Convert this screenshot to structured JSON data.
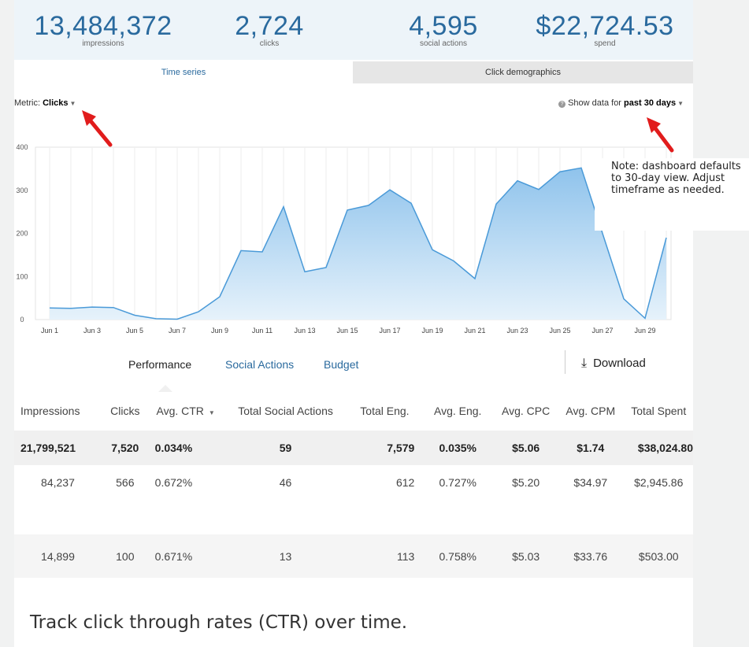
{
  "stats": [
    {
      "value": "13,484,372",
      "label": "impressions"
    },
    {
      "value": "2,724",
      "label": "clicks"
    },
    {
      "value": "4,595",
      "label": "social actions"
    },
    {
      "value": "$22,724.53",
      "label": "spend"
    }
  ],
  "tabs": {
    "time_series": "Time series",
    "click_demographics": "Click demographics"
  },
  "metric": {
    "prefix": "Metric:",
    "value": "Clicks"
  },
  "range": {
    "prefix": "Show data for",
    "value": "past 30 days"
  },
  "note": "Note: dashboard defaults to 30-day view. Adjust timeframe as needed.",
  "chart_data": {
    "type": "area",
    "x": [
      "Jun 1",
      "Jun 2",
      "Jun 3",
      "Jun 4",
      "Jun 5",
      "Jun 6",
      "Jun 7",
      "Jun 8",
      "Jun 9",
      "Jun 10",
      "Jun 11",
      "Jun 12",
      "Jun 13",
      "Jun 14",
      "Jun 15",
      "Jun 16",
      "Jun 17",
      "Jun 18",
      "Jun 19",
      "Jun 20",
      "Jun 21",
      "Jun 22",
      "Jun 23",
      "Jun 24",
      "Jun 25",
      "Jun 26",
      "Jun 27",
      "Jun 28",
      "Jun 29",
      "Jun 30"
    ],
    "x_tick_labels": [
      "Jun 1",
      "Jun 3",
      "Jun 5",
      "Jun 7",
      "Jun 9",
      "Jun 11",
      "Jun 13",
      "Jun 15",
      "Jun 17",
      "Jun 19",
      "Jun 21",
      "Jun 23",
      "Jun 25",
      "Jun 27",
      "Jun 29"
    ],
    "values": [
      27,
      26,
      29,
      28,
      10,
      2,
      1,
      18,
      53,
      160,
      157,
      262,
      111,
      121,
      254,
      265,
      301,
      270,
      162,
      136,
      95,
      268,
      322,
      302,
      343,
      352,
      200,
      48,
      3,
      190
    ],
    "ylim": [
      0,
      400
    ],
    "y_ticks": [
      0,
      100,
      200,
      300,
      400
    ],
    "grid": true,
    "colors": {
      "line": "#4a9ad8",
      "fill_top": "#8fc3ec",
      "fill_bottom": "#e6f2fb"
    }
  },
  "section_tabs": {
    "performance": "Performance",
    "social_actions": "Social Actions",
    "budget": "Budget"
  },
  "download": {
    "label": "Download"
  },
  "table": {
    "headers": [
      "Impressions",
      "Clicks",
      "Avg. CTR",
      "Total Social Actions",
      "Total Eng.",
      "Avg. Eng.",
      "Avg. CPC",
      "Avg. CPM",
      "Total Spent"
    ],
    "rows": [
      [
        "21,799,521",
        "7,520",
        "0.034%",
        "59",
        "7,579",
        "0.035%",
        "$5.06",
        "$1.74",
        "$38,024.80"
      ],
      [
        "84,237",
        "566",
        "0.672%",
        "46",
        "612",
        "0.727%",
        "$5.20",
        "$34.97",
        "$2,945.86"
      ],
      [
        "14,899",
        "100",
        "0.671%",
        "13",
        "113",
        "0.758%",
        "$5.03",
        "$33.76",
        "$503.00"
      ]
    ]
  },
  "footer": "Track click through rates (CTR) over time.",
  "colors": {
    "accent": "#2a6a9e",
    "arrow": "#e11c1c"
  }
}
